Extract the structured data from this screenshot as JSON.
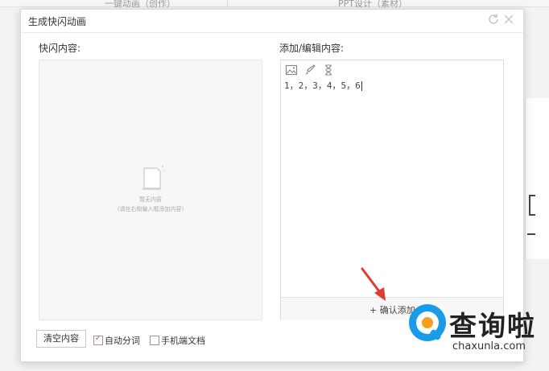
{
  "background": {
    "tabs": [
      "一键动画（创作）",
      "PPT设计（素材）"
    ]
  },
  "dialog": {
    "title": "生成快闪动画",
    "refresh_icon": "refresh-icon",
    "close_icon": "close-icon",
    "left_panel": {
      "label": "快闪内容:",
      "empty_title": "暂无内容",
      "empty_hint": "(请在右侧输入框添加内容)"
    },
    "right_panel": {
      "label": "添加/编辑内容:",
      "toolbar_icons": [
        "image-icon",
        "brush-icon",
        "hourglass-icon"
      ],
      "editor_value": "1，2，3，4，5，6",
      "confirm_label": "+ 确认添加"
    },
    "footer": {
      "clear_button": "清空内容",
      "auto_split": {
        "label": "自动分词",
        "checked": true
      },
      "mobile_doc": {
        "label": "手机端文档",
        "checked": false
      }
    }
  },
  "watermark": {
    "text": "查询啦",
    "url": "chaxunla.com"
  },
  "colors": {
    "accent_check": "#e05a3a",
    "annotation_arrow": "#e23a2e",
    "watermark_blue": "#1a9be8",
    "watermark_orange": "#f7a01b"
  }
}
